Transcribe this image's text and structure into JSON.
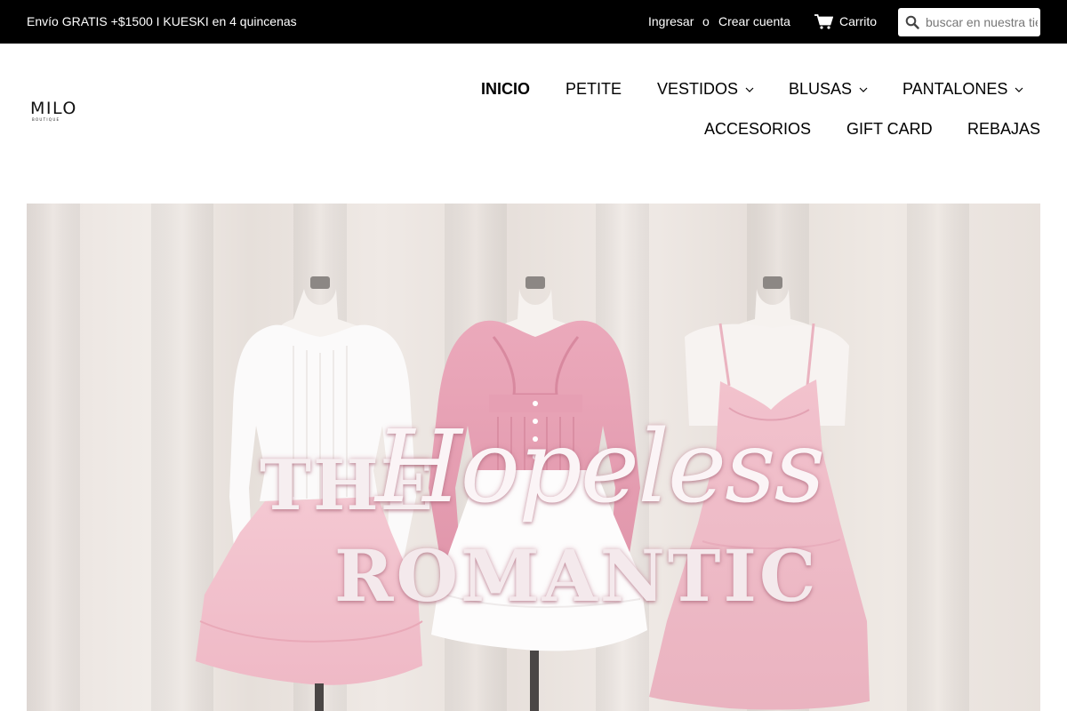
{
  "topbar": {
    "promo": "Envío GRATIS +$1500 I KUESKI en 4 quincenas",
    "login": "Ingresar",
    "or": "o",
    "register": "Crear cuenta",
    "cart": "Carrito",
    "search_placeholder": "buscar en nuestra tienda"
  },
  "logo": {
    "word": "MILO",
    "sub": "BOUTIQUE"
  },
  "nav": {
    "inicio": "INICIO",
    "petite": "PETITE",
    "vestidos": "VESTIDOS",
    "blusas": "BLUSAS",
    "pantalones": "PANTALONES",
    "accesorios": "ACCESORIOS",
    "gift_card": "GIFT CARD",
    "rebajas": "REBAJAS"
  },
  "hero": {
    "the": "THE",
    "hopeless": "Hopeless",
    "romantic": "ROMANTIC"
  },
  "colors": {
    "topbar_bg": "#000000",
    "text": "#000000",
    "pink": "#eaa2b6"
  },
  "icons": [
    "cart-icon",
    "search-icon",
    "chevron-down-icon"
  ]
}
